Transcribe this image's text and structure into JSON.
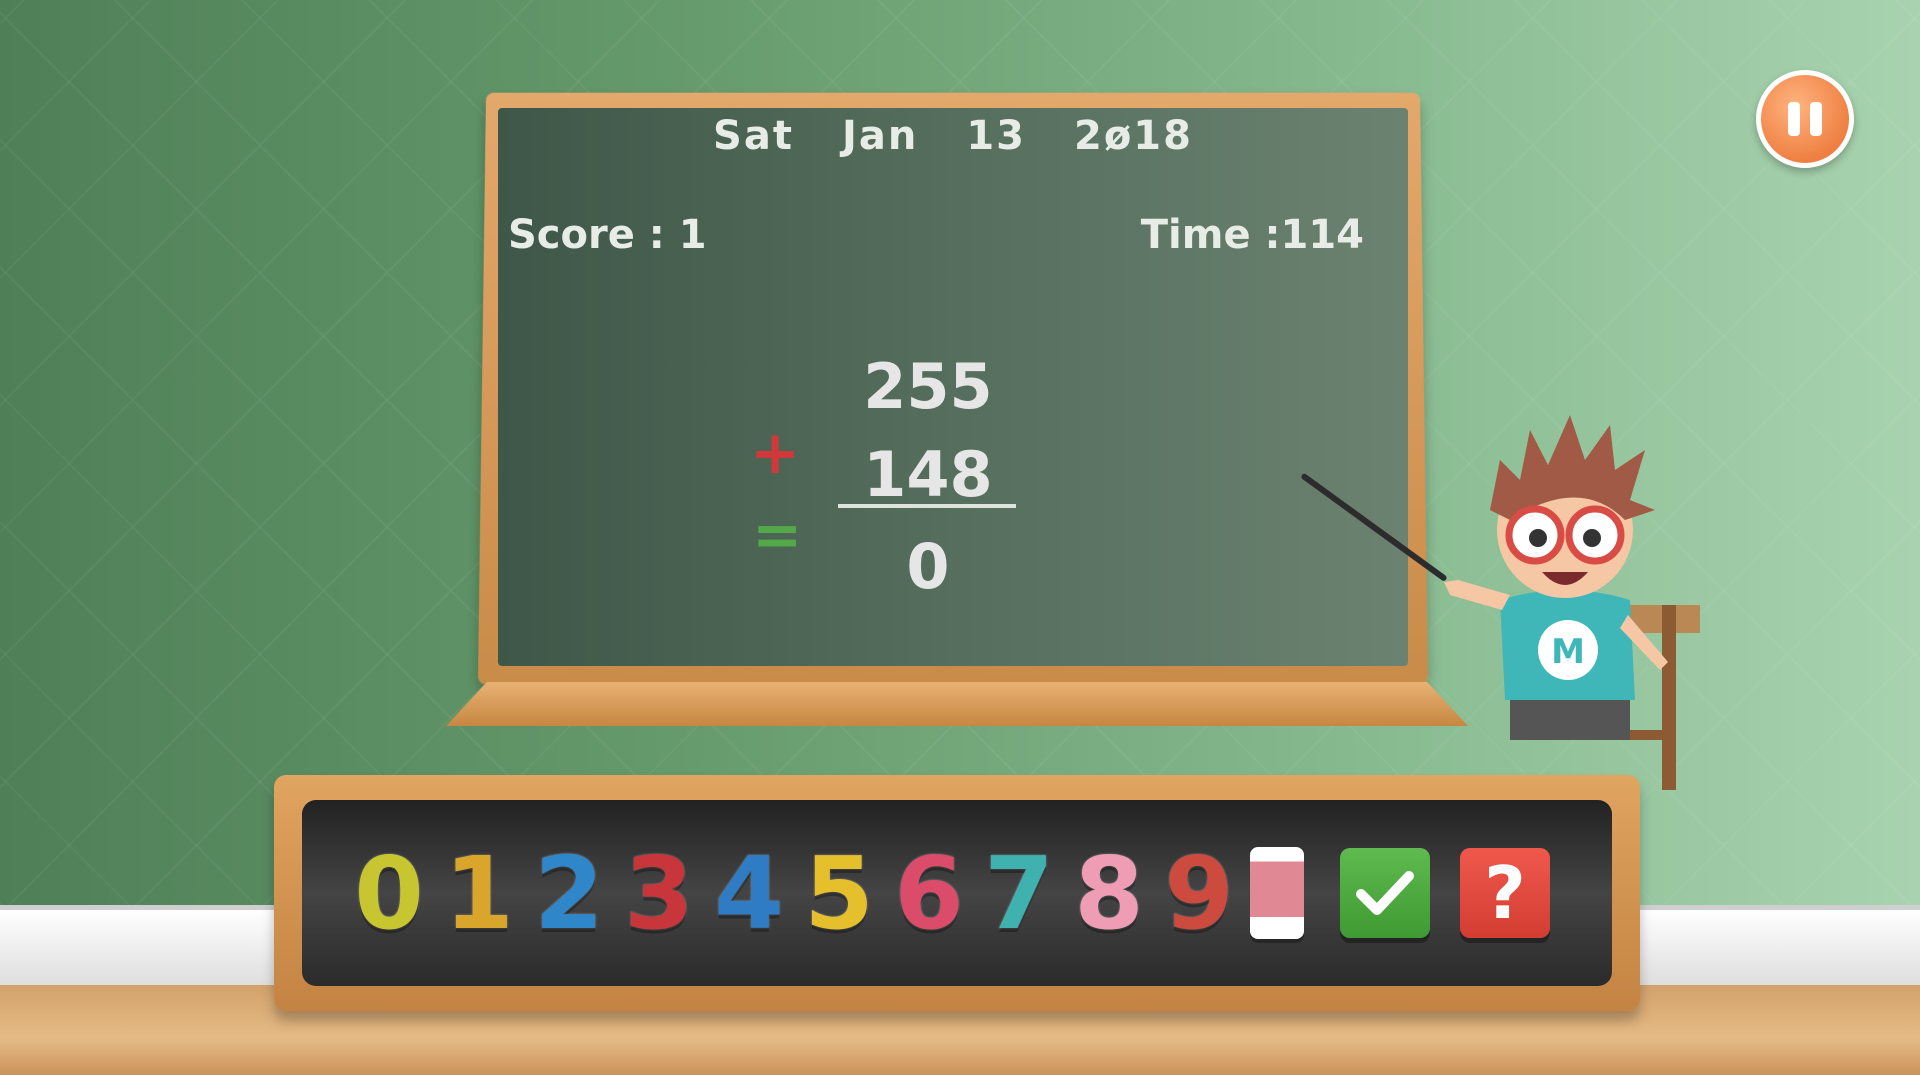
{
  "header": {
    "day": "Sat",
    "month": "Jan",
    "date": "13",
    "year": "2ø18"
  },
  "stats": {
    "score_text": "Score : 1",
    "time_text": "Time :114"
  },
  "problem": {
    "operand1": "255",
    "operand2": "148",
    "answer": "0",
    "operator": "+",
    "equals": "="
  },
  "keypad": {
    "digits": [
      "0",
      "1",
      "2",
      "3",
      "4",
      "5",
      "6",
      "7",
      "8",
      "9"
    ],
    "digit_colors": [
      "#c7c630",
      "#d9a62b",
      "#2f86c9",
      "#c8353a",
      "#2f7cc5",
      "#e6bf2c",
      "#db4b6a",
      "#3fb2b0",
      "#ef9db4",
      "#cd4a3f"
    ],
    "erase": "eraser-icon",
    "submit": "check-icon",
    "help_label": "?"
  },
  "controls": {
    "pause": "pause-icon"
  },
  "character": {
    "shirt_letter": "M"
  }
}
